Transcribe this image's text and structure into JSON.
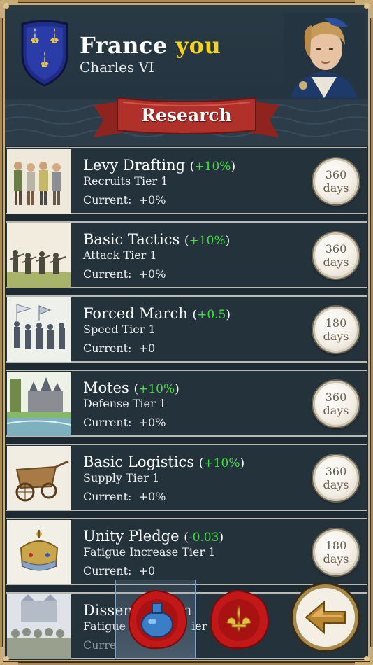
{
  "header": {
    "country": "France",
    "you_label": "you",
    "ruler": "Charles VI"
  },
  "banner": {
    "title": "Research"
  },
  "research_items": [
    {
      "name": "Levy Drafting",
      "bonus": "+10%",
      "tier": "Recruits Tier 1",
      "current_label": "Current:",
      "current_value": "+0%",
      "days_value": "360",
      "days_unit": "days",
      "image": "levy-soldiers-image"
    },
    {
      "name": "Basic Tactics",
      "bonus": "+10%",
      "tier": "Attack Tier 1",
      "current_label": "Current:",
      "current_value": "+0%",
      "days_value": "360",
      "days_unit": "days",
      "image": "tactics-soldiers-image"
    },
    {
      "name": "Forced March",
      "bonus": "+0.5",
      "tier": "Speed Tier 1",
      "current_label": "Current:",
      "current_value": "+0",
      "days_value": "180",
      "days_unit": "days",
      "image": "marching-army-image"
    },
    {
      "name": "Motes",
      "bonus": "+10%",
      "tier": "Defense Tier 1",
      "current_label": "Current:",
      "current_value": "+0%",
      "days_value": "360",
      "days_unit": "days",
      "image": "castle-moat-image"
    },
    {
      "name": "Basic Logistics",
      "bonus": "+10%",
      "tier": "Supply Tier 1",
      "current_label": "Current:",
      "current_value": "+0%",
      "days_value": "360",
      "days_unit": "days",
      "image": "supply-cart-image"
    },
    {
      "name": "Unity Pledge",
      "bonus": "-0.03",
      "tier": "Fatigue Increase Tier 1",
      "current_label": "Current:",
      "current_value": "+0",
      "days_value": "180",
      "days_unit": "days",
      "image": "crown-image"
    },
    {
      "name": "Dissen",
      "name_tail": "ssion",
      "tier_head": "Fatigue",
      "tier_tail": "ier 1",
      "current_label": "Curre",
      "image": "gathering-crowd-image"
    }
  ],
  "bottom_bar": {
    "potion_seal_icon": "potion-seal-icon",
    "fleur_seal_icon": "fleur-de-lis-seal-icon",
    "back_icon": "back-arrow-icon"
  },
  "colors": {
    "bonus_green": "#3fe03f",
    "you_yellow": "#f4d21e",
    "banner_red": "#b0302a"
  }
}
